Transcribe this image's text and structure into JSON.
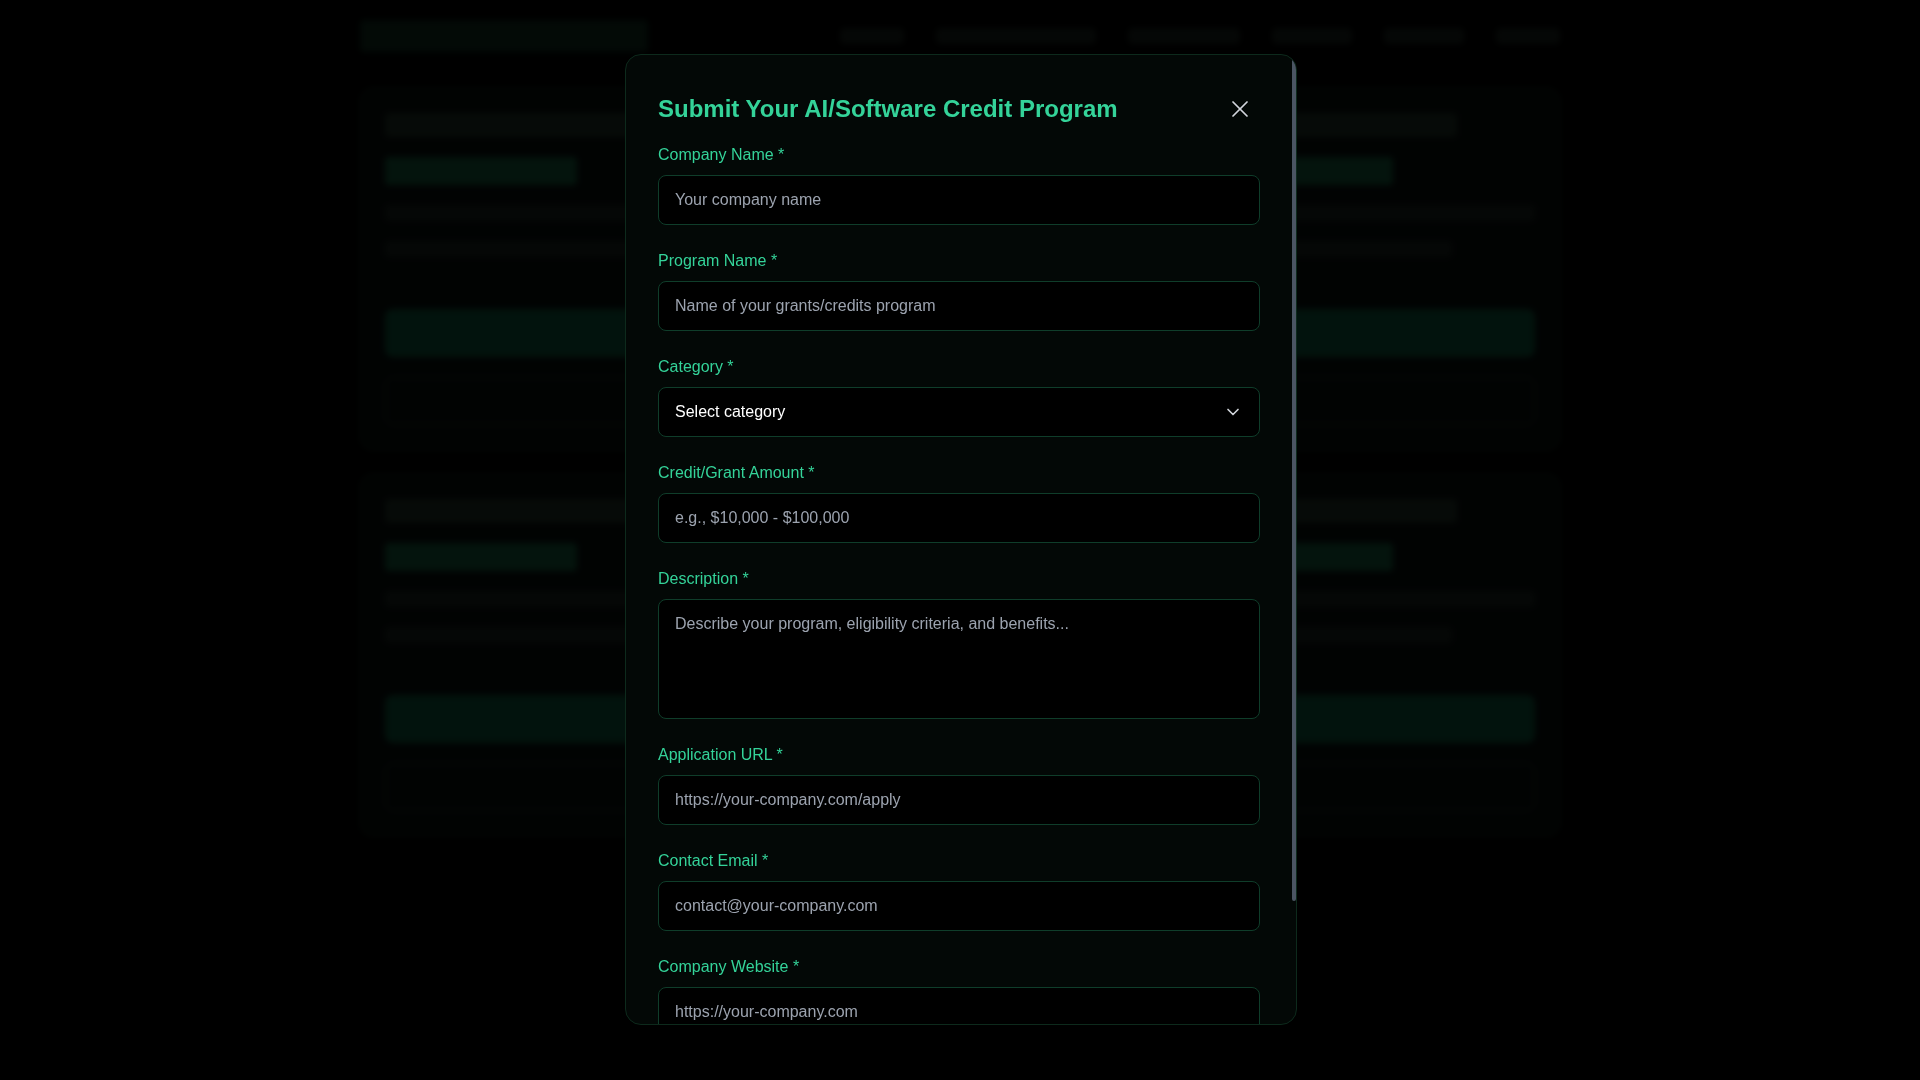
{
  "modal": {
    "title": "Submit Your AI/Software Credit Program",
    "fields": [
      {
        "kind": "input",
        "label": "Company Name *",
        "placeholder": "Your company name"
      },
      {
        "kind": "input",
        "label": "Program Name *",
        "placeholder": "Name of your grants/credits program"
      },
      {
        "kind": "select",
        "label": "Category *",
        "value": "Select category"
      },
      {
        "kind": "input",
        "label": "Credit/Grant Amount *",
        "placeholder": "e.g., $10,000 - $100,000"
      },
      {
        "kind": "textarea",
        "label": "Description *",
        "placeholder": "Describe your program, eligibility criteria, and benefits..."
      },
      {
        "kind": "input",
        "label": "Application URL *",
        "placeholder": "https://your-company.com/apply"
      },
      {
        "kind": "input",
        "label": "Contact Email *",
        "placeholder": "contact@your-company.com"
      },
      {
        "kind": "input",
        "label": "Company Website *",
        "placeholder": "https://your-company.com"
      }
    ]
  }
}
